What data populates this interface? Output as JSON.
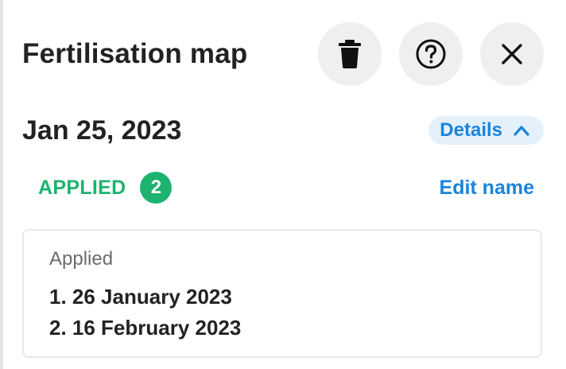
{
  "header": {
    "title": "Fertilisation map",
    "actions": [
      {
        "icon": "trash-icon",
        "label": "delete"
      },
      {
        "icon": "help-circle-icon",
        "label": "help"
      },
      {
        "icon": "close-icon",
        "label": "close"
      }
    ]
  },
  "date_row": {
    "date": "Jan 25, 2023",
    "details_label": "Details"
  },
  "status_row": {
    "status_label": "APPLIED",
    "status_count": "2",
    "edit_label": "Edit name"
  },
  "applied_card": {
    "heading": "Applied",
    "items": [
      "1. 26 January 2023",
      "2. 16 February 2023"
    ]
  },
  "colors": {
    "accent_blue": "#1a84dc",
    "accent_green": "#1db36f",
    "button_bg": "#efefef",
    "text_dark": "#222222"
  }
}
